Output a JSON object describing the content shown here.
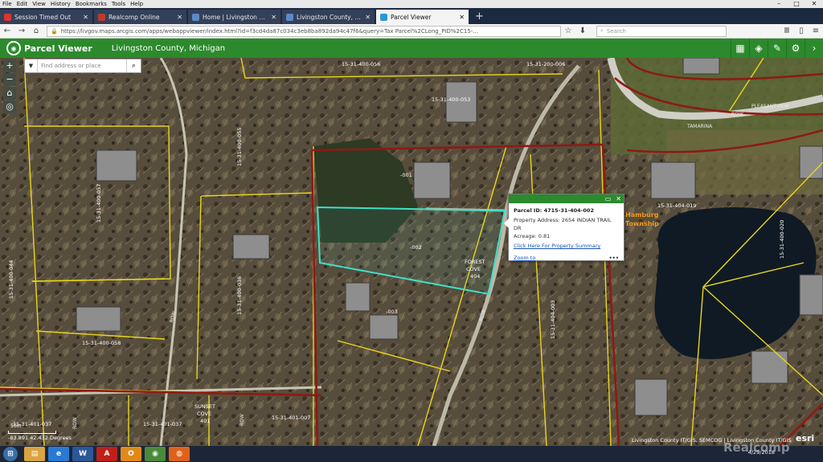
{
  "browser": {
    "menu": [
      "File",
      "Edit",
      "View",
      "History",
      "Bookmarks",
      "Tools",
      "Help"
    ],
    "tabs": [
      {
        "label": "Session Timed Out",
        "color": "#d33"
      },
      {
        "label": "Realcomp Online",
        "color": "#c0392b"
      },
      {
        "label": "Home | Livingston County, Mi",
        "color": "#5a8ac9"
      },
      {
        "label": "Livingston County, Michigan",
        "color": "#5a8ac9"
      },
      {
        "label": "Parcel Viewer",
        "color": "#2a9ad2"
      }
    ],
    "url": "https://livgov.maps.arcgis.com/apps/webappviewer/index.html?id=f3cd4da87c034c3eb8ba892da94c47f6&query=Tax Parcel%2CLong_PID%2C15-...",
    "search_placeholder": "Search"
  },
  "app": {
    "title": "Parcel Viewer",
    "subtitle": "Livingston County, Michigan"
  },
  "map_search": {
    "placeholder": "Find address or place"
  },
  "popup": {
    "title": "Parcel ID: 4715-31-404-002",
    "address": "Property Address: 2654 INDIAN TRAIL DR",
    "acreage": "Acreage: 0.81",
    "summary_link": "Click Here For Property Summary",
    "zoom": "Zoom to",
    "more": "•••"
  },
  "map_labels": {
    "p1": "15-31-400-056",
    "p2": "15-31-200-006",
    "p3": "15-31-400-053",
    "p4": "15-31-400-057",
    "p5": "15-31-400-055",
    "p6": "15-31-400-036",
    "p7": "15-31-400-044",
    "p8": "15-31-400-058",
    "p9": "15-31-401-037",
    "p10": "15-31-401-037",
    "p11": "15-31-401-007",
    "p12": "15-31-404-019",
    "p13": "15-31-400-020",
    "p14": "15-31-404-003",
    "p15": "-001",
    "p16": "-002",
    "p17": "-003",
    "forest": "FOREST",
    "cove": "COVE",
    "num404": "404",
    "sunset": "SUNSET",
    "cove2": "COVE",
    "num401": "401",
    "twp1": "Hamburg",
    "twp2": "Township",
    "tamarina": "TAMARINA",
    "pleasant": "PLEASANTVIEW",
    "row1": "ROW",
    "row2": "ROW",
    "row3": "ROW",
    "row4": "ROW",
    "row5": "ROW"
  },
  "status": {
    "coords": "-83.891 42.432 Degrees",
    "scale": "50m",
    "attribution": "Livingston County IT/GIS, SEMCOG | Livingston County IT/GIS",
    "esri": "esri"
  },
  "taskbar": {
    "clock": "4/29/2018",
    "watermark": "Realcomp"
  }
}
